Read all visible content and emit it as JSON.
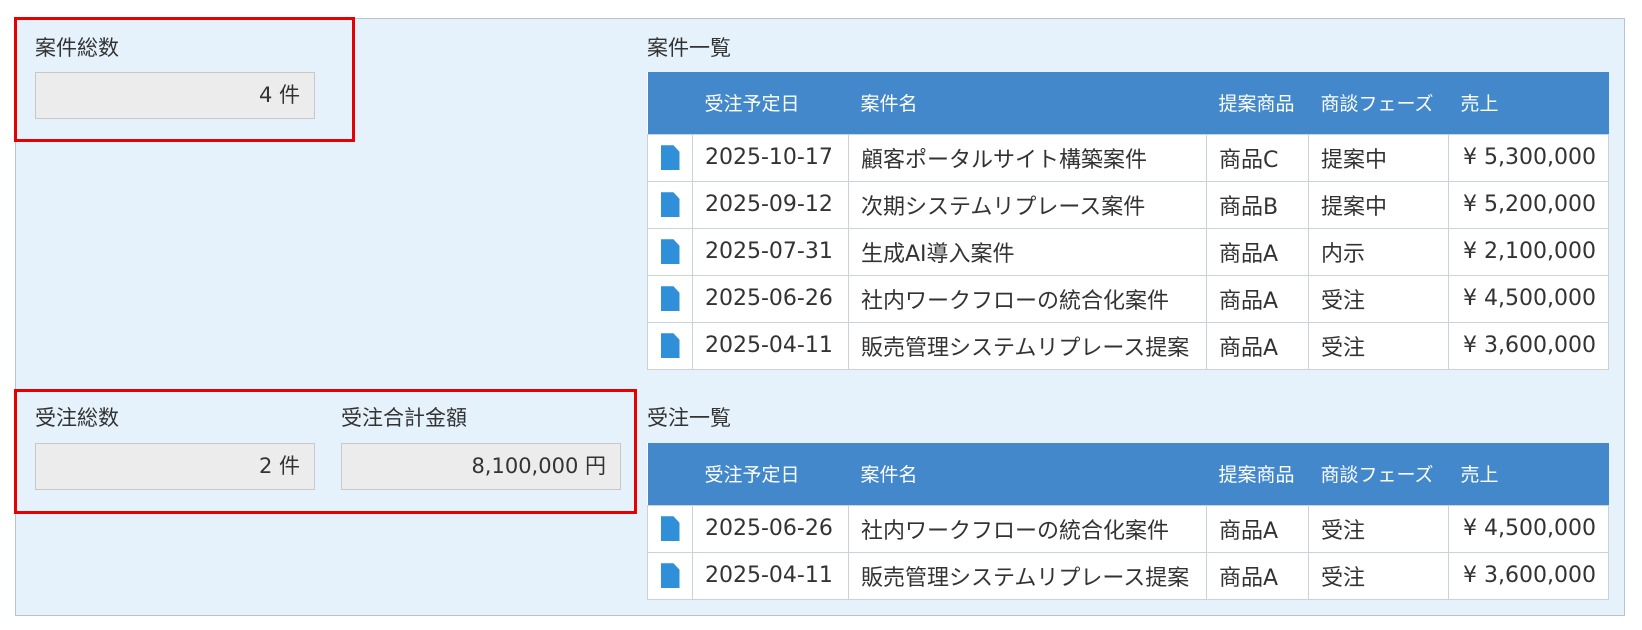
{
  "summary": {
    "case_total_label": "案件総数",
    "case_total_value": "4 件",
    "order_total_label": "受注総数",
    "order_total_value": "2 件",
    "order_amount_label": "受注合計金額",
    "order_amount_value": "8,100,000 円"
  },
  "case_list": {
    "title": "案件一覧",
    "headers": [
      "",
      "受注予定日",
      "案件名",
      "提案商品",
      "商談フェーズ",
      "売上"
    ],
    "rows": [
      {
        "icon": "document-icon",
        "date": "2025-10-17",
        "name": "顧客ポータルサイト構築案件",
        "product": "商品C",
        "phase": "提案中",
        "sales": "¥ 5,300,000"
      },
      {
        "icon": "document-icon",
        "date": "2025-09-12",
        "name": "次期システムリプレース案件",
        "product": "商品B",
        "phase": "提案中",
        "sales": "¥ 5,200,000"
      },
      {
        "icon": "document-icon",
        "date": "2025-07-31",
        "name": "生成AI導入案件",
        "product": "商品A",
        "phase": "内示",
        "sales": "¥ 2,100,000"
      },
      {
        "icon": "document-icon",
        "date": "2025-06-26",
        "name": "社内ワークフローの統合化案件",
        "product": "商品A",
        "phase": "受注",
        "sales": "¥ 4,500,000"
      },
      {
        "icon": "document-icon",
        "date": "2025-04-11",
        "name": "販売管理システムリプレース提案",
        "product": "商品A",
        "phase": "受注",
        "sales": "¥ 3,600,000"
      }
    ]
  },
  "order_list": {
    "title": "受注一覧",
    "headers": [
      "",
      "受注予定日",
      "案件名",
      "提案商品",
      "商談フェーズ",
      "売上"
    ],
    "rows": [
      {
        "icon": "document-icon",
        "date": "2025-06-26",
        "name": "社内ワークフローの統合化案件",
        "product": "商品A",
        "phase": "受注",
        "sales": "¥ 4,500,000"
      },
      {
        "icon": "document-icon",
        "date": "2025-04-11",
        "name": "販売管理システムリプレース提案",
        "product": "商品A",
        "phase": "受注",
        "sales": "¥ 3,600,000"
      }
    ]
  },
  "colors": {
    "panel_bg": "#e6f2fb",
    "header_bg": "#4288ca",
    "highlight_border": "#e60000",
    "icon": "#2f8fd8"
  }
}
